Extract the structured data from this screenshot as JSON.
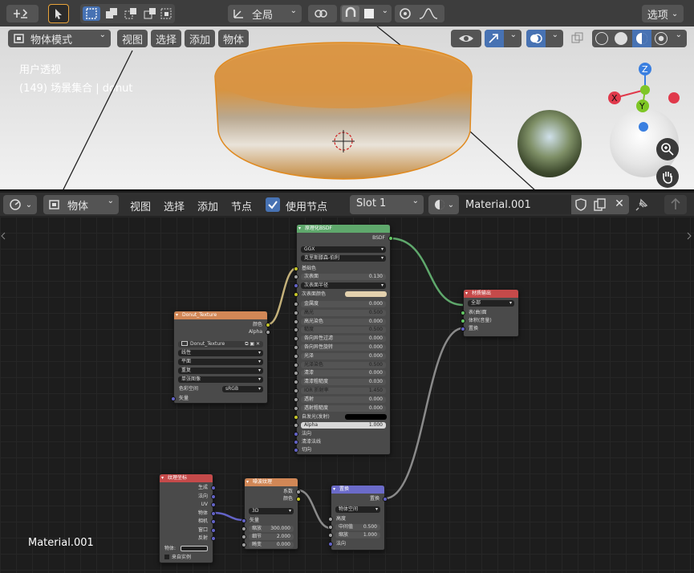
{
  "viewport": {
    "header": {
      "select_label": "全局",
      "options_label": "选项",
      "mode_label": "物体模式",
      "menu": [
        "视图",
        "选择",
        "添加",
        "物体"
      ]
    },
    "overlay": {
      "view_name": "用户透视",
      "collection": "(149) 场景集合 | donut"
    },
    "gizmo": {
      "x": "X",
      "y": "Y",
      "z": "Z"
    }
  },
  "node_editor": {
    "header": {
      "type_label": "物体",
      "menu": [
        "视图",
        "选择",
        "添加",
        "节点"
      ],
      "use_nodes_label": "使用节点",
      "slot_label": "Slot 1",
      "material_name": "Material.001"
    },
    "corner_label": "Material.001",
    "nodes": {
      "bsdf": {
        "title": "原理化BSDF",
        "output": "BSDF",
        "distribution": "GGX",
        "subsurface_method": "克里斯滕森-伯利",
        "base_color": "基础色",
        "subsurface": {
          "label": "次表面",
          "value": "0.130"
        },
        "subsurface_radius": "次表面半径",
        "subsurface_color": "次表面颜色",
        "rows": [
          {
            "label": "金属度",
            "value": "0.000"
          },
          {
            "label": "高光",
            "value": "0.500"
          },
          {
            "label": "高光染色",
            "value": "0.000"
          },
          {
            "label": "糙度",
            "value": "0.500"
          },
          {
            "label": "各向异性过滤",
            "value": "0.000"
          },
          {
            "label": "各向异性旋转",
            "value": "0.000"
          },
          {
            "label": "光泽",
            "value": "0.000"
          },
          {
            "label": "光泽染色",
            "value": "0.500"
          },
          {
            "label": "清漆",
            "value": "0.000"
          },
          {
            "label": "清漆粗糙度",
            "value": "0.030"
          },
          {
            "label": "IOR 折射率",
            "value": "1.450"
          },
          {
            "label": "透射",
            "value": "0.000"
          },
          {
            "label": "透射粗糙度",
            "value": "0.000"
          }
        ],
        "emission": "自发光(发射)",
        "alpha": {
          "label": "Alpha",
          "value": "1.000"
        },
        "normal": "法向",
        "clearcoat_normal": "清漆法线",
        "tangent": "切向"
      },
      "texture": {
        "title": "Donut_Texture",
        "color": "颜色",
        "alpha": "Alpha",
        "image_name": "Donut_Texture",
        "interpolation": "线性",
        "projection": "平面",
        "extension": "重复",
        "source": "单张图像",
        "colorspace_label": "色彩空间",
        "colorspace_value": "sRGB",
        "vector": "矢量"
      },
      "output": {
        "title": "材质输出",
        "target": "全部",
        "surface": "表(曲)面",
        "volume": "体积(音量)",
        "displacement": "置换"
      },
      "texcoord": {
        "title": "纹理坐标",
        "outputs": [
          "生成",
          "法向",
          "UV",
          "物体",
          "相机",
          "窗口",
          "反射"
        ],
        "object_label": "物体:",
        "from_instancer": "来自实例"
      },
      "noise": {
        "title": "噪波纹理",
        "fac": "系数",
        "color": "颜色",
        "dimensions": "3D",
        "vector": "矢量",
        "scale": {
          "label": "缩放",
          "value": "300.000"
        },
        "detail": {
          "label": "细节",
          "value": "2.000"
        },
        "distortion": {
          "label": "畸变",
          "value": "0.000"
        }
      },
      "displacement": {
        "title": "置换",
        "output": "置换",
        "space": "物体空间",
        "height": "高度",
        "midlevel": {
          "label": "中间值",
          "value": "0.500"
        },
        "scale": {
          "label": "缩放",
          "value": "1.000"
        },
        "normal": "法向"
      }
    }
  },
  "colors": {
    "shader_header": "#5fa86c",
    "texture_header": "#d18756",
    "output_header": "#c54a4a",
    "input_header": "#c54a4a",
    "vector_header": "#6b6bc9",
    "accent": "#4772b3"
  }
}
